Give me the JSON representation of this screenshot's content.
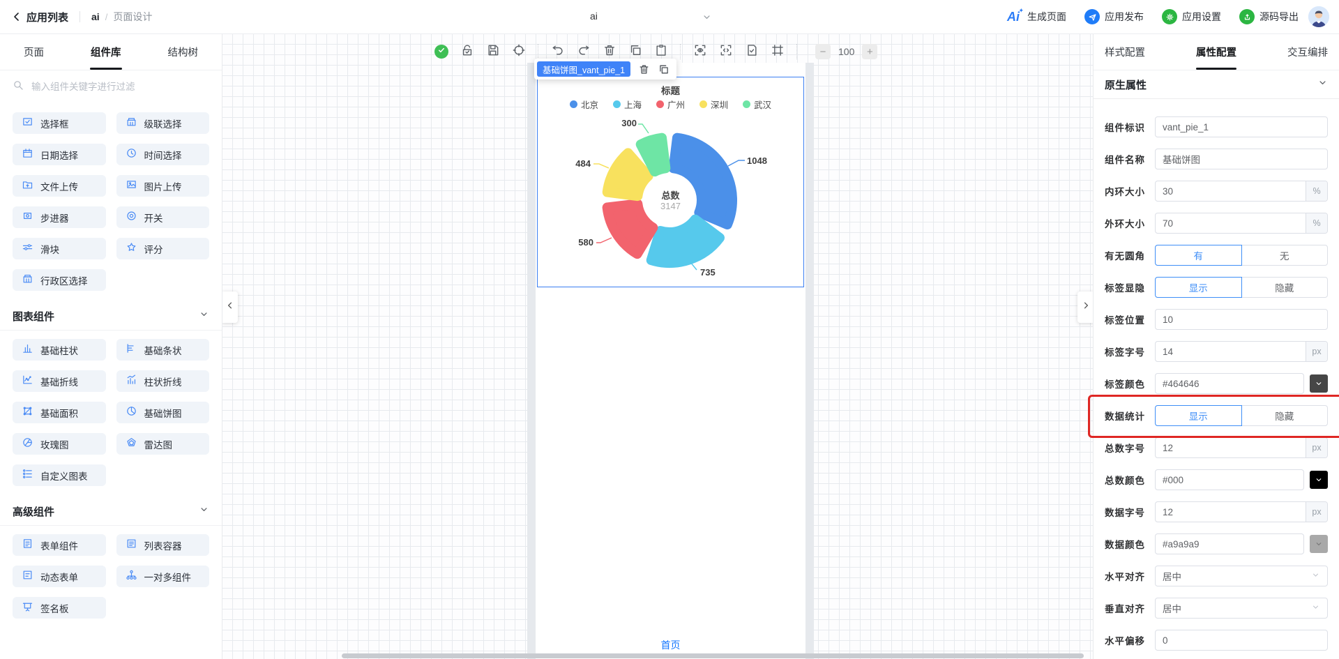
{
  "header": {
    "back_label": "应用列表",
    "app_name": "ai",
    "breadcrumb_separator": "/",
    "page_name": "页面设计",
    "page_select_value": "ai",
    "actions": [
      {
        "label": "生成页面",
        "icon": "ai-logo-icon",
        "chip_color": ""
      },
      {
        "label": "应用发布",
        "icon": "publish-plane-icon",
        "chip_color": "#1f7cf8"
      },
      {
        "label": "应用设置",
        "icon": "settings-gear-icon",
        "chip_color": "#2cb642"
      },
      {
        "label": "源码导出",
        "icon": "code-export-icon",
        "chip_color": "#2cb642"
      }
    ]
  },
  "sidebar": {
    "tabs": [
      {
        "label": "页面",
        "active": false
      },
      {
        "label": "组件库",
        "active": true
      },
      {
        "label": "结构树",
        "active": false
      }
    ],
    "search_placeholder": "输入组件关键字进行过滤",
    "basic_items": [
      {
        "label": "选择框",
        "icon": "checkbox-icon"
      },
      {
        "label": "级联选择",
        "icon": "cascade-icon"
      },
      {
        "label": "日期选择",
        "icon": "calendar-icon"
      },
      {
        "label": "时间选择",
        "icon": "clock-icon"
      },
      {
        "label": "文件上传",
        "icon": "folder-upload-icon"
      },
      {
        "label": "图片上传",
        "icon": "image-upload-icon"
      },
      {
        "label": "步进器",
        "icon": "stepper-icon"
      },
      {
        "label": "开关",
        "icon": "switch-icon"
      },
      {
        "label": "滑块",
        "icon": "slider-icon"
      },
      {
        "label": "评分",
        "icon": "star-icon"
      },
      {
        "label": "行政区选择",
        "icon": "district-icon"
      }
    ],
    "sections": [
      {
        "title": "图表组件",
        "items": [
          {
            "label": "基础柱状",
            "icon": "bar-chart-icon"
          },
          {
            "label": "基础条状",
            "icon": "hbar-chart-icon"
          },
          {
            "label": "基础折线",
            "icon": "line-chart-icon"
          },
          {
            "label": "柱状折线",
            "icon": "barline-chart-icon"
          },
          {
            "label": "基础面积",
            "icon": "area-chart-icon"
          },
          {
            "label": "基础饼图",
            "icon": "pie-chart-icon"
          },
          {
            "label": "玫瑰图",
            "icon": "rose-chart-icon"
          },
          {
            "label": "雷达图",
            "icon": "radar-chart-icon"
          },
          {
            "label": "自定义图表",
            "icon": "custom-chart-icon"
          }
        ]
      },
      {
        "title": "高级组件",
        "items": [
          {
            "label": "表单组件",
            "icon": "form-icon"
          },
          {
            "label": "列表容器",
            "icon": "list-container-icon"
          },
          {
            "label": "动态表单",
            "icon": "dynamic-form-icon"
          },
          {
            "label": "一对多组件",
            "icon": "one-to-many-icon"
          },
          {
            "label": "签名板",
            "icon": "signature-icon"
          }
        ]
      }
    ]
  },
  "toolbar": {
    "icons": [
      "status-ok-icon",
      "unlock-icon",
      "save-icon",
      "target-icon",
      "divider",
      "undo-icon",
      "redo-icon",
      "delete-icon",
      "copy-icon",
      "paste-icon",
      "divider",
      "preview-icon",
      "code-icon",
      "page-check-icon",
      "frame-icon",
      "divider"
    ],
    "zoom_value": "100"
  },
  "canvas": {
    "selected_label": "基础饼图_vant_pie_1",
    "footer_link": "首页"
  },
  "chart_data": {
    "type": "pie",
    "title": "标题",
    "legend_position": "top",
    "inner_radius_pct": 30,
    "outer_radius_pct": 70,
    "total_label": "总数",
    "total_value": 3147,
    "points": [
      {
        "name": "北京",
        "value": 1048,
        "color": "#4b90e9"
      },
      {
        "name": "上海",
        "value": 735,
        "color": "#56c9ec"
      },
      {
        "name": "广州",
        "value": 580,
        "color": "#f2636d"
      },
      {
        "name": "深圳",
        "value": 484,
        "color": "#f8e15e"
      },
      {
        "name": "武汉",
        "value": 300,
        "color": "#6ee5a5"
      }
    ]
  },
  "panel": {
    "tabs": [
      {
        "label": "样式配置",
        "active": false
      },
      {
        "label": "属性配置",
        "active": true
      },
      {
        "label": "交互编排",
        "active": false
      }
    ],
    "section_title": "原生属性",
    "highlight_color": "#df2724",
    "fields": [
      {
        "key": "component-id",
        "label": "组件标识",
        "type": "input",
        "value": "vant_pie_1"
      },
      {
        "key": "component-name",
        "label": "组件名称",
        "type": "input",
        "value": "基础饼图"
      },
      {
        "key": "inner-ring-size",
        "label": "内环大小",
        "type": "input",
        "value": "30",
        "suffix": "%"
      },
      {
        "key": "outer-ring-size",
        "label": "外环大小",
        "type": "input",
        "value": "70",
        "suffix": "%"
      },
      {
        "key": "rounded-corner",
        "label": "有无圆角",
        "type": "segmented",
        "options": [
          "有",
          "无"
        ],
        "active": 0
      },
      {
        "key": "label-visibility",
        "label": "标签显隐",
        "type": "segmented",
        "options": [
          "显示",
          "隐藏"
        ],
        "active": 0
      },
      {
        "key": "label-position",
        "label": "标签位置",
        "type": "input",
        "value": "10"
      },
      {
        "key": "label-font-size",
        "label": "标签字号",
        "type": "input",
        "value": "14",
        "suffix": "px"
      },
      {
        "key": "label-color",
        "label": "标签颜色",
        "type": "color",
        "value": "#464646",
        "swatch": "#464646"
      },
      {
        "key": "data-statistics",
        "label": "数据统计",
        "type": "segmented",
        "options": [
          "显示",
          "隐藏"
        ],
        "active": 0,
        "highlighted": true
      },
      {
        "key": "total-font-size",
        "label": "总数字号",
        "type": "input",
        "value": "12",
        "suffix": "px"
      },
      {
        "key": "total-color",
        "label": "总数颜色",
        "type": "color",
        "value": "#000",
        "swatch": "#000000"
      },
      {
        "key": "data-font-size",
        "label": "数据字号",
        "type": "input",
        "value": "12",
        "suffix": "px"
      },
      {
        "key": "data-color",
        "label": "数据颜色",
        "type": "color",
        "value": "#a9a9a9",
        "swatch": "#a9a9a9"
      },
      {
        "key": "horizontal-align",
        "label": "水平对齐",
        "type": "select",
        "value": "居中"
      },
      {
        "key": "vertical-align",
        "label": "垂直对齐",
        "type": "select",
        "value": "居中"
      },
      {
        "key": "horizontal-offset",
        "label": "水平偏移",
        "type": "input",
        "value": "0"
      }
    ]
  }
}
